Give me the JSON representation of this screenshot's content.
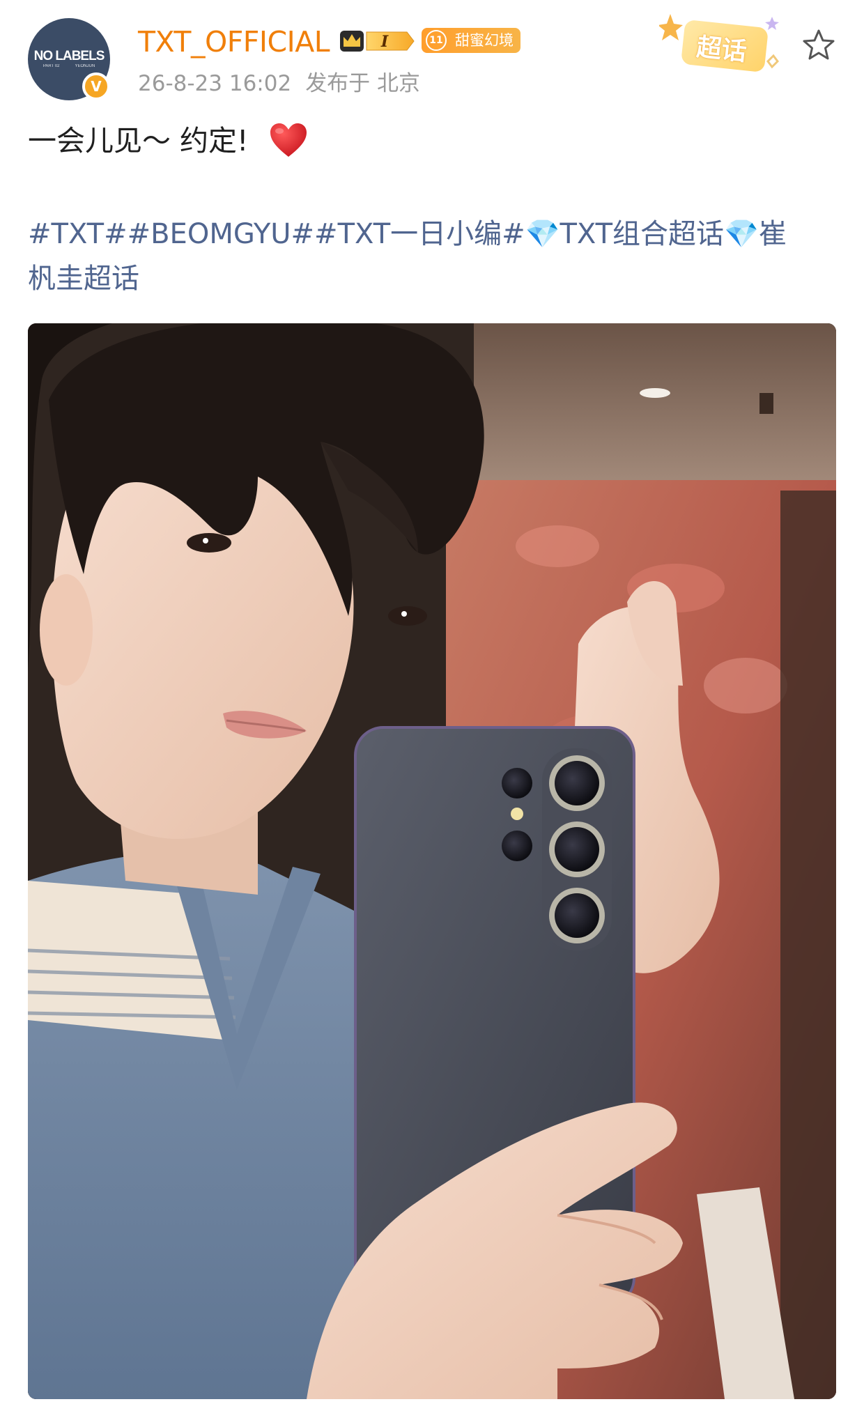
{
  "post": {
    "author": {
      "avatar_text": "NO LABELS",
      "avatar_subtext_left": "PART 02",
      "avatar_subtext_right": "YEONJUN",
      "verified_mark": "V",
      "username": "TXT_OFFICIAL",
      "vip_level": "I",
      "fan_badge_level": "11",
      "fan_badge_label": "甜蜜幻境"
    },
    "meta": {
      "date": "26-8-23 16:02",
      "location": "发布于 北京"
    },
    "supertopic_label": "超话",
    "text": "一会儿见～ 约定!",
    "topics_line1": "#TXT##BEOMGYU##TXT一日小编#💎TXT组合超话💎崔",
    "topics_line2": "杋圭超话"
  },
  "icons": {
    "star": "star-outline-icon",
    "heart": "red-heart-icon",
    "verified": "verified-v-icon",
    "crown": "crown-icon"
  },
  "colors": {
    "username": "#f07f0a",
    "topic_link": "#50658f",
    "meta_gray": "#9a9a9a",
    "badge_orange": "#f6a623"
  }
}
